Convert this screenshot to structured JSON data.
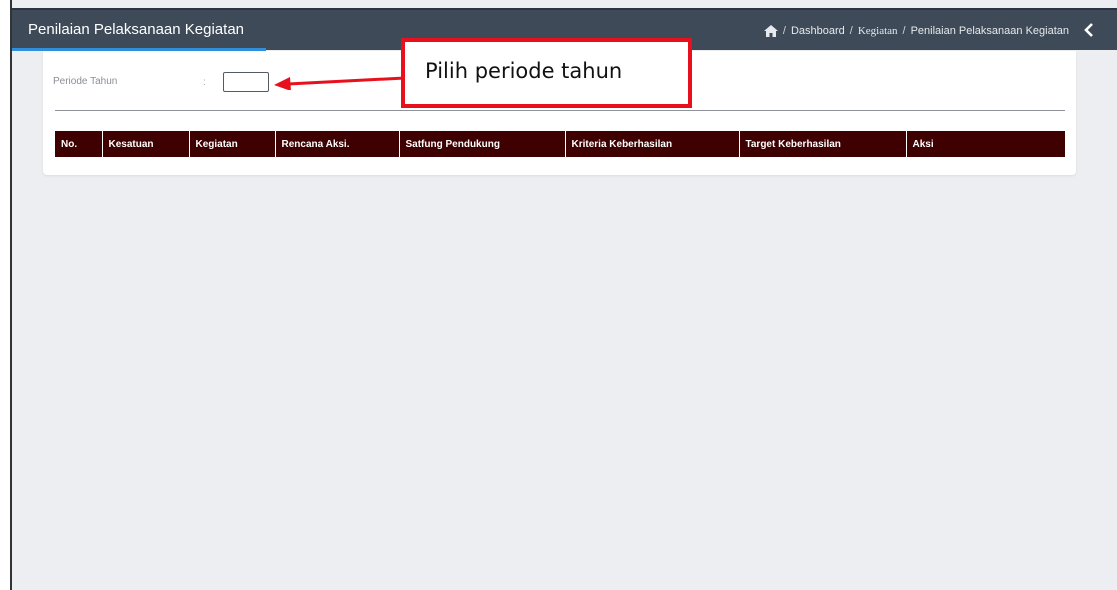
{
  "header": {
    "title": "Penilaian Pelaksanaan Kegiatan",
    "breadcrumb": {
      "home_icon": "home-icon",
      "items": [
        "Dashboard",
        "Kegiatan",
        "Penilaian Pelaksanaan Kegiatan"
      ],
      "separator": "/"
    },
    "collapse_icon": "chevron-left-icon"
  },
  "filter": {
    "label": "Periode Tahun",
    "colon": ":",
    "value": ""
  },
  "table": {
    "columns": [
      "No.",
      "Kesatuan",
      "Kegiatan",
      "Rencana Aksi.",
      "Satfung Pendukung",
      "Kriteria Keberhasilan",
      "Target Keberhasilan",
      "Aksi"
    ],
    "rows": []
  },
  "annotation": {
    "callout_text": "Pilih periode tahun",
    "color": "#e8101c"
  },
  "colors": {
    "header_bg": "#3e4a57",
    "accent": "#2f8fdb",
    "table_header_bg": "#3e0000"
  }
}
